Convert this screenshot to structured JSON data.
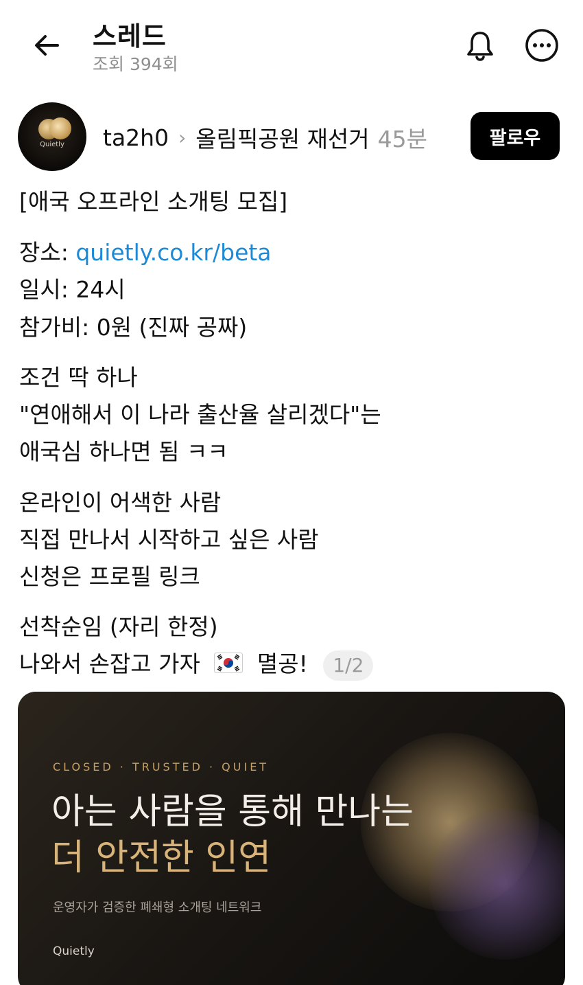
{
  "header": {
    "title": "스레드",
    "views": "조회 394회",
    "back_icon": "arrow-left-icon",
    "bell_icon": "bell-icon",
    "more_icon": "more-horizontal-icon"
  },
  "post": {
    "avatar_brand": "Quietly",
    "author": "ta2h0",
    "community": "올림픽공원 재선거",
    "time": "45분",
    "follow_label": "팔로우",
    "lines": {
      "heading": "[애국 오프라인 소개팅 모집]",
      "place_label": "장소: ",
      "place_link": "quietly.co.kr/beta",
      "date": "일시: 24시",
      "fee": "참가비: 0원 (진짜 공짜)",
      "cond1": "조건 딱 하나",
      "cond2": "\"연애해서 이 나라 출산율 살리겠다\"는",
      "cond3": "애국심 하나면 됨 ㅋㅋ",
      "who1": "온라인이 어색한 사람",
      "who2": "직접 만나서 시작하고 싶은 사람",
      "who3": "신청은 프로필 링크",
      "end1": "선착순임 (자리 한정)",
      "end2_pre": "나와서 손잡고 가자",
      "end2_post": "멸공!",
      "page_indicator": "1/2"
    },
    "flag_icon": "south-korea-flag-icon"
  },
  "card": {
    "tag": "CLOSED · TRUSTED · QUIET",
    "headline1": "아는 사람을 통해 만나는",
    "headline2": "더 안전한 인연",
    "subtitle": "운영자가 검증한 폐쇄형 소개팅 네트워크",
    "brand": "Quietly"
  },
  "colors": {
    "link": "#1e8ad6",
    "follow_bg": "#000000",
    "card_accent": "#d9b47a",
    "muted": "#8e8e8e"
  }
}
